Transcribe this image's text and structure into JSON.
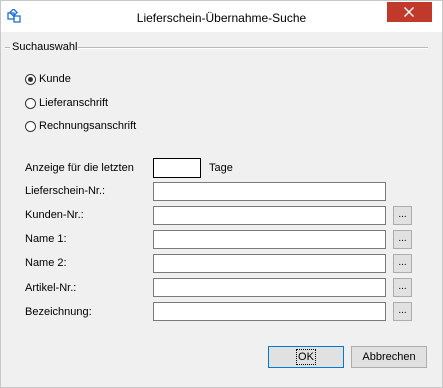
{
  "window": {
    "title": "Lieferschein-Übernahme-Suche"
  },
  "group": {
    "label": "Suchauswahl"
  },
  "radios": [
    {
      "label": "Kunde",
      "checked": true
    },
    {
      "label": "Lieferanschrift",
      "checked": false
    },
    {
      "label": "Rechnungsanschrift",
      "checked": false
    }
  ],
  "fields": {
    "days_label": "Anzeige für die letzten",
    "days_value": "",
    "days_unit": "Tage",
    "delivery_note_label": "Lieferschein-Nr.:",
    "delivery_note_value": "",
    "customer_label": "Kunden-Nr.:",
    "customer_value": "",
    "name1_label": "Name 1:",
    "name1_value": "",
    "name2_label": "Name 2:",
    "name2_value": "",
    "article_label": "Artikel-Nr.:",
    "article_value": "",
    "description_label": "Bezeichnung:",
    "description_value": ""
  },
  "lookup_button_label": "...",
  "buttons": {
    "ok": "OK",
    "cancel": "Abbrechen"
  },
  "colors": {
    "close_button": "#c0392b",
    "default_button_border": "#0078d7",
    "app_icon": "#1e6fd9"
  },
  "icons": {
    "app": "app-icon",
    "close": "close-icon"
  }
}
